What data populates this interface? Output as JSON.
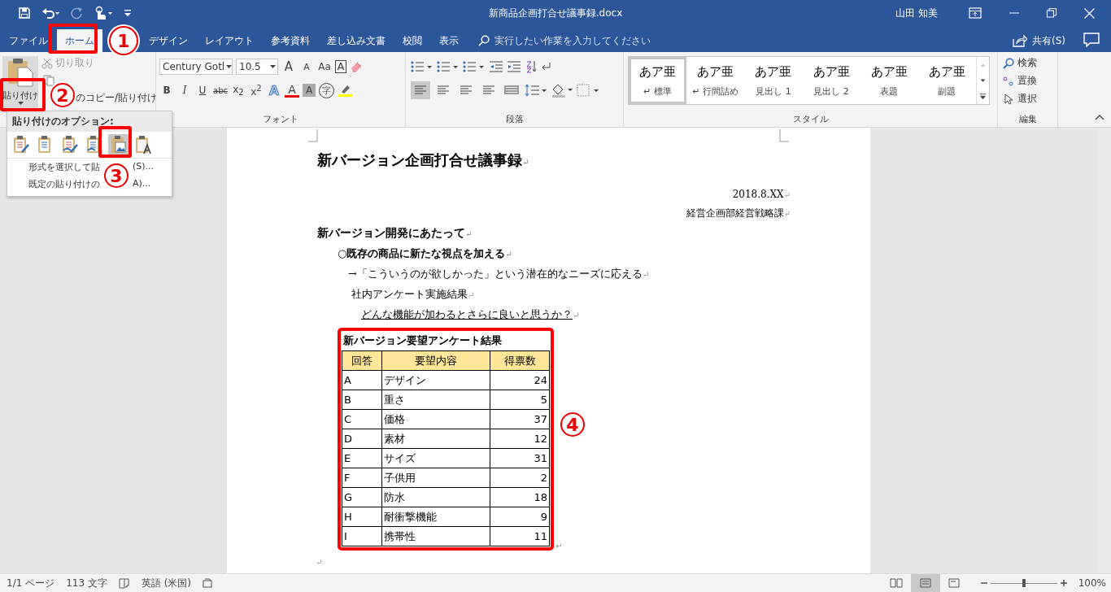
{
  "window": {
    "title": "新商品企画打合せ議事録.docx",
    "user": "山田 知美"
  },
  "tabs": [
    {
      "label": "ファイル",
      "selected": false
    },
    {
      "label": "ホーム",
      "selected": true
    },
    {
      "label": "デザイン",
      "selected": false
    },
    {
      "label": "レイアウト",
      "selected": false
    },
    {
      "label": "参考資料",
      "selected": false
    },
    {
      "label": "差し込み文書",
      "selected": false
    },
    {
      "label": "校閲",
      "selected": false
    },
    {
      "label": "表示",
      "selected": false
    }
  ],
  "tell_me": {
    "placeholder": "実行したい作業を入力してください"
  },
  "share": {
    "label": "共有(S)"
  },
  "clipboard": {
    "paste": "貼り付け",
    "cut": {
      "label": "切り取り",
      "disabled": true
    },
    "format_painter": "のコピー/貼り付け"
  },
  "font": {
    "name": "Century Gotl",
    "size": "10.5",
    "row1": [
      {
        "label": "A",
        "kind": "grow"
      },
      {
        "label": "A",
        "kind": "shrink"
      },
      {
        "label": "Aa",
        "kind": "case"
      },
      {
        "label": "A",
        "kind": "box"
      }
    ],
    "row2": [
      {
        "label": "B",
        "kind": "bold"
      },
      {
        "label": "I",
        "kind": "italic"
      },
      {
        "label": "U",
        "kind": "underline"
      },
      {
        "label": "abc",
        "kind": "strike"
      },
      {
        "label": "x$_{2}$",
        "kind": "plain"
      },
      {
        "label": "x$^{2}$",
        "kind": "plain"
      },
      {
        "label": "A",
        "kind": "effect"
      },
      {
        "label": "A",
        "kind": "color"
      },
      {
        "label": "A",
        "kind": "shade"
      },
      {
        "label": "字",
        "kind": "circle"
      }
    ],
    "group": "フォント"
  },
  "paragraph": {
    "group": "段落",
    "alignments": [
      {
        "selected": true
      },
      {
        "selected": false
      },
      {
        "selected": false
      },
      {
        "selected": false
      },
      {
        "selected": false
      }
    ]
  },
  "styles": {
    "group": "スタイル",
    "items": [
      {
        "sample": "あア亜",
        "name": "↵ 標準",
        "selected": true
      },
      {
        "sample": "あア亜",
        "name": "↵ 行間詰め",
        "selected": false
      },
      {
        "sample": "あア亜",
        "name": "見出し 1",
        "selected": false
      },
      {
        "sample": "あア亜",
        "name": "見出し 2",
        "selected": false
      },
      {
        "sample": "あア亜",
        "name": "表題",
        "selected": false
      },
      {
        "sample": "あア亜",
        "name": "副題",
        "selected": false
      }
    ]
  },
  "editing": {
    "group": "編集",
    "items": [
      "検索",
      "置換",
      "選択"
    ]
  },
  "paste_menu": {
    "header": "貼り付けのオプション:",
    "options": [
      {
        "selected": false
      },
      {
        "selected": false
      },
      {
        "selected": false
      },
      {
        "selected": false
      },
      {
        "selected": true
      },
      {
        "selected": false
      }
    ],
    "items": [
      {
        "visible_text": "形式を選択して貼",
        "tail": "(S)..."
      },
      {
        "visible_text": "既定の貼り付けの",
        "tail": "A)..."
      }
    ]
  },
  "document": {
    "lines": [
      {
        "kind": "title",
        "text": "新バージョン企画打合せ議事録",
        "mark": "↵"
      },
      {
        "kind": "right",
        "text": "2018.8.XX",
        "mark": "↵"
      },
      {
        "kind": "right",
        "text": "経営企画部経営戦略課",
        "mark": "↵"
      },
      {
        "kind": "heading",
        "text": "新バージョン開発にあたって",
        "mark": "↵"
      },
      {
        "kind": "point",
        "text": "○既存の商品に新たな視点を加える",
        "mark": "↵"
      },
      {
        "kind": "body",
        "text": "→「こういうのが欲しかった」という潜在的なニーズに応える",
        "mark": "↵"
      },
      {
        "kind": "sub",
        "text": "社内アンケート実施結果",
        "mark": "↵"
      },
      {
        "kind": "question",
        "text": "どんな機能が加わるとさらに良いと思うか？",
        "mark": "↵"
      }
    ],
    "table": {
      "caption": "新バージョン要望アンケート結果",
      "columns": [
        "回答",
        "要望内容",
        "得票数"
      ],
      "rows": [
        [
          "A",
          "デザイン",
          "24"
        ],
        [
          "B",
          "重さ",
          "5"
        ],
        [
          "C",
          "価格",
          "37"
        ],
        [
          "D",
          "素材",
          "12"
        ],
        [
          "E",
          "サイズ",
          "31"
        ],
        [
          "F",
          "子供用",
          "2"
        ],
        [
          "G",
          "防水",
          "18"
        ],
        [
          "H",
          "耐衝撃機能",
          "9"
        ],
        [
          "I",
          "携帯性",
          "11"
        ]
      ],
      "cell_mark": "↵"
    },
    "end_mark": "↵"
  },
  "annotations": [
    "1",
    "2",
    "3",
    "4"
  ],
  "status_bar": {
    "page": "1/1 ページ",
    "words": "113 文字",
    "language": "英語 (米国)",
    "views": [
      {
        "selected": false
      },
      {
        "selected": true
      },
      {
        "selected": false
      }
    ],
    "zoom": {
      "level": 0.5,
      "label": "100%"
    }
  }
}
